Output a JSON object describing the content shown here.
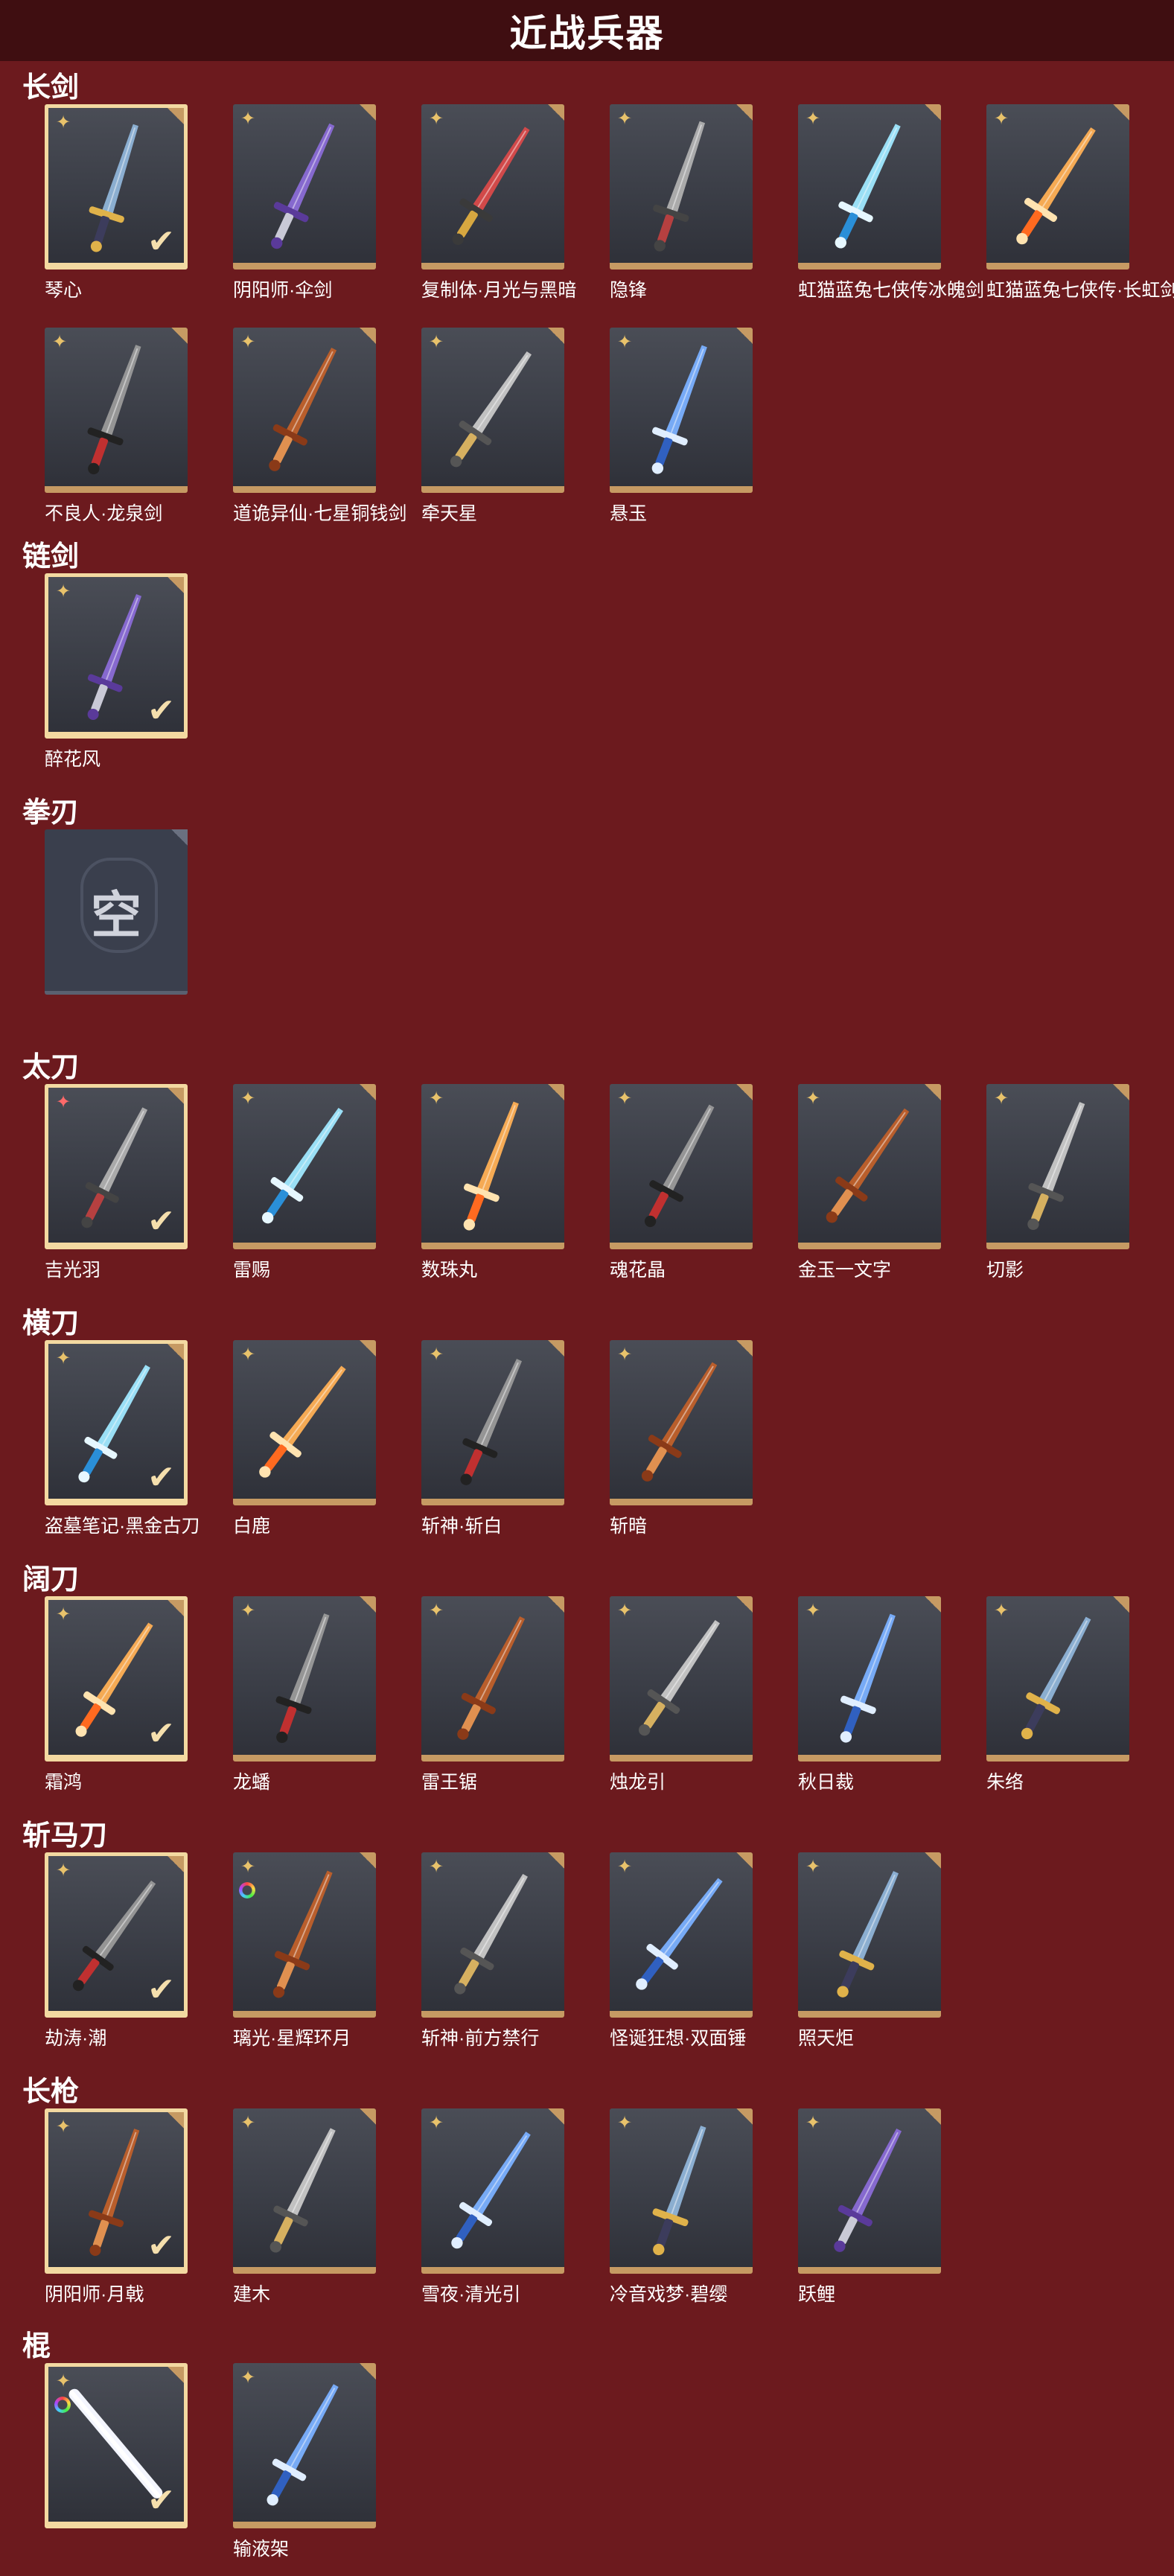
{
  "header": {
    "title": "近战兵器"
  },
  "sections": [
    {
      "title": "长剑",
      "items": [
        {
          "name": "琴心",
          "selected": true
        },
        {
          "name": "阴阳师·伞剑"
        },
        {
          "name": "复制体·月光与黑暗"
        },
        {
          "name": "隐锋"
        },
        {
          "name": "虹猫蓝兔七侠传冰魄剑"
        },
        {
          "name": "虹猫蓝兔七侠传·长虹剑"
        },
        {
          "name": "不良人·龙泉剑"
        },
        {
          "name": "道诡异仙·七星铜钱剑"
        },
        {
          "name": "牵天星"
        },
        {
          "name": "悬玉"
        }
      ]
    },
    {
      "title": "链剑",
      "items": [
        {
          "name": "醉花风",
          "selected": true
        }
      ]
    },
    {
      "title": "拳刃",
      "empty_label": "空"
    },
    {
      "title": "太刀",
      "items": [
        {
          "name": "吉光羽",
          "selected": true
        },
        {
          "name": "雷赐"
        },
        {
          "name": "数珠丸"
        },
        {
          "name": "魂花晶"
        },
        {
          "name": "金玉一文字"
        },
        {
          "name": "切影"
        }
      ]
    },
    {
      "title": "横刀",
      "items": [
        {
          "name": "盗墓笔记·黑金古刀",
          "selected": true
        },
        {
          "name": "白鹿"
        },
        {
          "name": "斩神·斩白"
        },
        {
          "name": "斩暗"
        }
      ]
    },
    {
      "title": "阔刀",
      "items": [
        {
          "name": "霜鸿",
          "selected": true
        },
        {
          "name": "龙蟠"
        },
        {
          "name": "雷王锯"
        },
        {
          "name": "烛龙引"
        },
        {
          "name": "秋日裁"
        },
        {
          "name": "朱络"
        }
      ]
    },
    {
      "title": "斩马刀",
      "items": [
        {
          "name": "劫涛·潮",
          "selected": true
        },
        {
          "name": "璃光·星辉环月"
        },
        {
          "name": "斩神·前方禁行"
        },
        {
          "name": "怪诞狂想·双面锤"
        },
        {
          "name": "照天炬"
        }
      ]
    },
    {
      "title": "长枪",
      "items": [
        {
          "name": "阴阳师·月戟",
          "selected": true
        },
        {
          "name": "建木"
        },
        {
          "name": "雪夜·清光引"
        },
        {
          "name": "冷音戏梦·碧缨"
        },
        {
          "name": "跃鲤"
        }
      ]
    },
    {
      "title": "棍",
      "items": [
        {
          "name": "",
          "selected": true
        },
        {
          "name": "输液架"
        }
      ]
    }
  ],
  "colors": {
    "background": "#6c1a1e",
    "header_bg": "#3f0e11",
    "card_border": "#c69a63",
    "selected_border": "#f3d9a1",
    "badge": "#e8c26b"
  },
  "icons": {
    "badge": "sparkle-icon",
    "selected": "checkmark-icon",
    "corner": "corner-fold-icon"
  }
}
